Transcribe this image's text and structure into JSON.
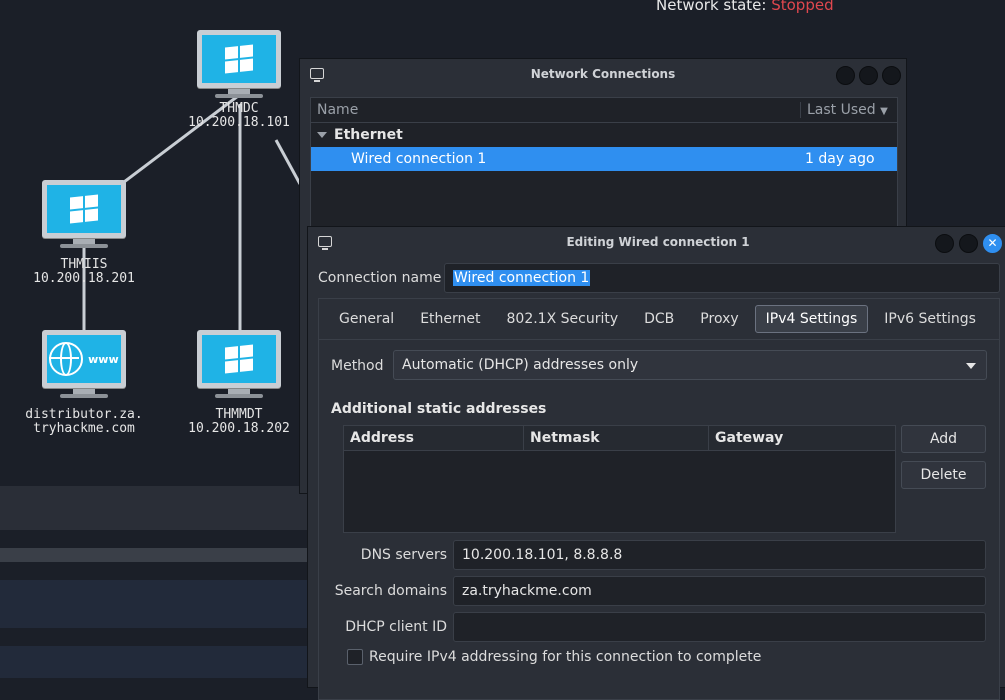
{
  "network_map": {
    "status_label": "Network state: ",
    "status_value": "Stopped",
    "status_color": "#e0474e",
    "nodes": [
      {
        "name": "THMDC",
        "ip": "10.200.18.101",
        "icon": "windows-monitor-icon"
      },
      {
        "name": "THMIIS",
        "ip": "10.200.18.201",
        "icon": "windows-monitor-icon"
      },
      {
        "name": "distributor.za.",
        "ip": "tryhackme.com",
        "icon": "www-monitor-icon"
      },
      {
        "name": "THMMDT",
        "ip": "10.200.18.202",
        "icon": "windows-monitor-icon"
      }
    ],
    "www_text": "www"
  },
  "nc_window": {
    "title": "Network Connections",
    "columns": {
      "name": "Name",
      "last_used": "Last Used"
    },
    "group": "Ethernet",
    "connection": {
      "name": "Wired connection 1",
      "last_used": "1 day ago"
    }
  },
  "edit_window": {
    "title": "Editing Wired connection 1",
    "close_glyph": "✕",
    "connection_name_label": "Connection name",
    "connection_name_value": "Wired connection 1",
    "tabs": [
      "General",
      "Ethernet",
      "802.1X Security",
      "DCB",
      "Proxy",
      "IPv4 Settings",
      "IPv6 Settings"
    ],
    "active_tab": "IPv4 Settings",
    "method_label": "Method",
    "method_value": "Automatic (DHCP) addresses only",
    "static_heading": "Additional static addresses",
    "addr_columns": [
      "Address",
      "Netmask",
      "Gateway"
    ],
    "add_button": "Add",
    "delete_button": "Delete",
    "dns_label": "DNS servers",
    "dns_value": "10.200.18.101, 8.8.8.8",
    "search_label": "Search domains",
    "search_value": "za.tryhackme.com",
    "dhcp_label": "DHCP client ID",
    "dhcp_value": "",
    "require_label": "Require IPv4 addressing for this connection to complete"
  },
  "colors": {
    "accent": "#2f8ff0",
    "background": "#1b1f28",
    "window": "#2b2f37"
  }
}
